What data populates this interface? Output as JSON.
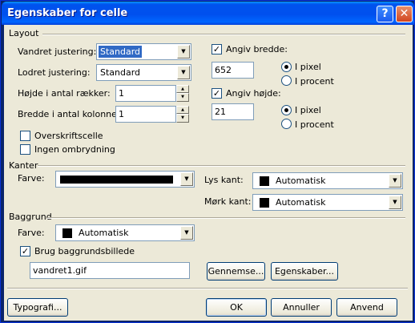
{
  "window": {
    "title": "Egenskaber for celle"
  },
  "layout": {
    "section": "Layout",
    "horiz_label": "Vandret justering:",
    "horiz_value": "Standard",
    "vert_label": "Lodret justering:",
    "vert_value": "Standard",
    "rows_label": "Højde i antal rækker:",
    "rows_value": "1",
    "cols_label": "Bredde i antal kolonner:",
    "cols_value": "1",
    "header_cell": {
      "label": "Overskriftscelle",
      "checked": false
    },
    "no_wrap": {
      "label": "Ingen ombrydning",
      "checked": false
    },
    "width": {
      "label": "Angiv bredde:",
      "checked": true,
      "value": "652",
      "pixel": "I pixel",
      "percent": "I procent",
      "unit": "pixel"
    },
    "height": {
      "label": "Angiv højde:",
      "checked": true,
      "value": "21",
      "pixel": "I pixel",
      "percent": "I procent",
      "unit": "pixel"
    }
  },
  "borders": {
    "section": "Kanter",
    "color_label": "Farve:",
    "color_value": "",
    "light_label": "Lys kant:",
    "light_value": "Automatisk",
    "dark_label": "Mørk kant:",
    "dark_value": "Automatisk"
  },
  "background": {
    "section": "Baggrund",
    "color_label": "Farve:",
    "color_value": "Automatisk",
    "use_image": {
      "label": "Brug baggrundsbillede",
      "checked": true
    },
    "image_value": "vandret1.gif",
    "browse": "Gennemse...",
    "properties": "Egenskaber..."
  },
  "footer": {
    "style": "Typografi...",
    "ok": "OK",
    "cancel": "Annuller",
    "apply": "Anvend"
  },
  "colors": {
    "title_bar": "#0054e3",
    "dialog_bg": "#ece9d8",
    "selection": "#316ac5"
  }
}
